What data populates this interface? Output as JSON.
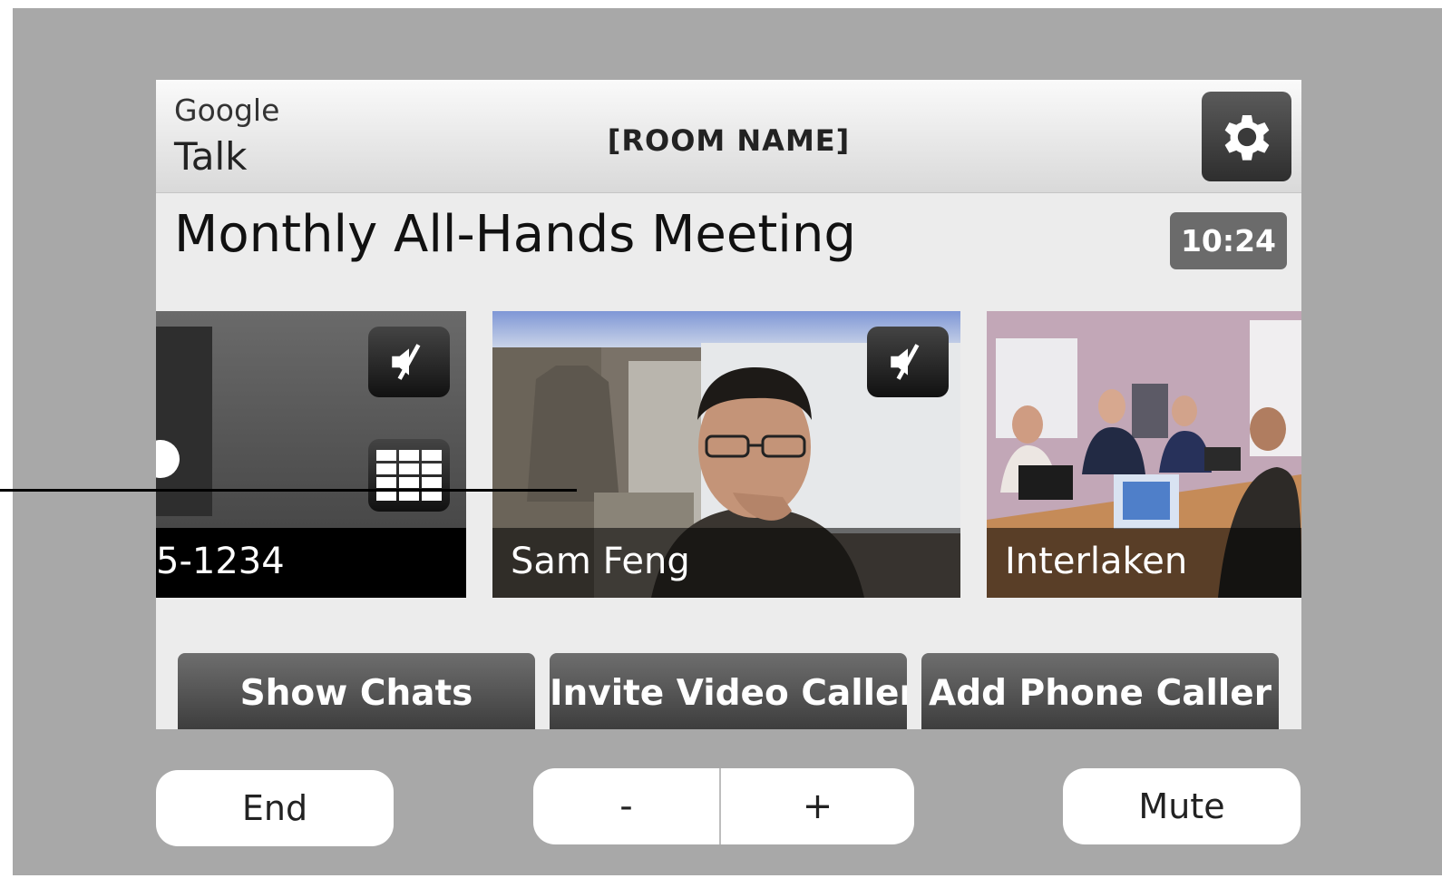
{
  "header": {
    "logo_line1": "Google",
    "logo_line2": "Talk",
    "room_name": "[ROOM NAME]",
    "settings_icon": "gear-icon"
  },
  "meeting": {
    "title": "Monthly All-Hands Meeting",
    "timer": "10:24"
  },
  "participants": [
    {
      "label": "5-1234",
      "muted": true,
      "icons": [
        "speaker-muted-icon",
        "keypad-icon"
      ]
    },
    {
      "label": "Sam Feng",
      "muted": true,
      "icons": [
        "speaker-muted-icon"
      ]
    },
    {
      "label": "Interlaken",
      "muted": false,
      "icons": []
    }
  ],
  "actions": {
    "show_chats": "Show Chats",
    "invite_video_caller": "Invite Video Caller",
    "add_phone_caller": "Add Phone Caller"
  },
  "controls": {
    "end": "End",
    "volume_down": "-",
    "volume_up": "+",
    "mute": "Mute"
  },
  "colors": {
    "frame": "#a8a8a8",
    "screen": "#ececec",
    "dark_button": "#4a4a4a",
    "timer_badge": "#6b6b6b"
  }
}
